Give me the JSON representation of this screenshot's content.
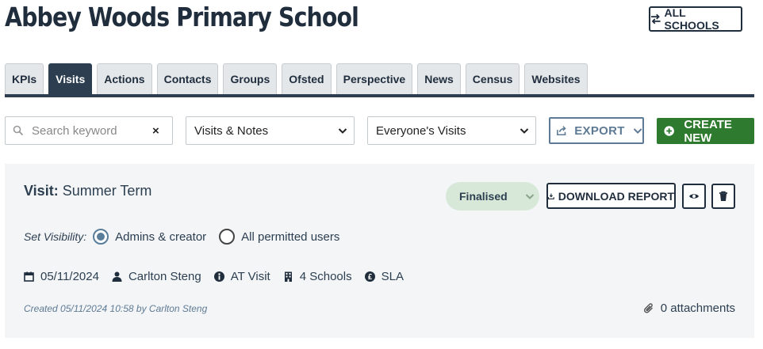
{
  "header": {
    "title": "Abbey Woods Primary School",
    "all_schools_label": "ALL SCHOOLS"
  },
  "tabs": [
    {
      "label": "KPIs",
      "active": false
    },
    {
      "label": "Visits",
      "active": true
    },
    {
      "label": "Actions",
      "active": false
    },
    {
      "label": "Contacts",
      "active": false
    },
    {
      "label": "Groups",
      "active": false
    },
    {
      "label": "Ofsted",
      "active": false
    },
    {
      "label": "Perspective",
      "active": false
    },
    {
      "label": "News",
      "active": false
    },
    {
      "label": "Census",
      "active": false
    },
    {
      "label": "Websites",
      "active": false
    }
  ],
  "toolbar": {
    "search_placeholder": "Search keyword",
    "search_value": "",
    "clear_label": "×",
    "type_filter": "Visits & Notes",
    "owner_filter": "Everyone's Visits",
    "export_label": "EXPORT",
    "create_label": "CREATE NEW"
  },
  "visit": {
    "title_prefix": "Visit:",
    "title": "Summer Term",
    "status": "Finalised",
    "download_label": "DOWNLOAD REPORT",
    "visibility_label": "Set Visibility:",
    "visibility_options": [
      {
        "label": "Admins & creator",
        "checked": true
      },
      {
        "label": "All permitted users",
        "checked": false
      }
    ],
    "date": "05/11/2024",
    "person": "Carlton Steng",
    "visit_type": "AT Visit",
    "schools": "4 Schools",
    "funding": "SLA",
    "created": "Created 05/11/2024 10:58 by Carlton Steng",
    "attachments": "0 attachments"
  },
  "colors": {
    "primary_dark": "#2c3e50",
    "create_green": "#2e7a2e",
    "status_green_bg": "#d8e8d8",
    "export_blue": "#5f7a94",
    "card_bg": "#f3f5f7"
  }
}
